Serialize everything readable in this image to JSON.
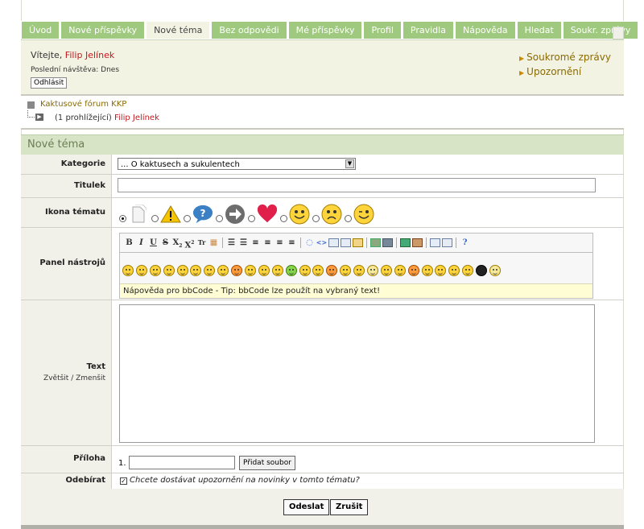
{
  "tabs": [
    {
      "label": "Úvod"
    },
    {
      "label": "Nové příspěvky"
    },
    {
      "label": "Nové téma",
      "active": true
    },
    {
      "label": "Bez odpovědi"
    },
    {
      "label": "Mé příspěvky"
    },
    {
      "label": "Profil"
    },
    {
      "label": "Pravidla"
    },
    {
      "label": "Nápověda"
    },
    {
      "label": "Hledat"
    },
    {
      "label": "Soukr. zprávy"
    }
  ],
  "user": {
    "welcome": "Vítejte,",
    "name": "Filip Jelínek",
    "last_visit": "Poslední návštěva: Dnes",
    "logout": "Odhlásit"
  },
  "right_links": [
    "Soukromé zprávy",
    "Upozornění"
  ],
  "breadcrumb": {
    "forum": "Kaktusové fórum KKP",
    "viewing": "(1 prohlížející)",
    "viewer": "Filip Jelínek"
  },
  "form": {
    "title": "Nové téma",
    "category_label": "Kategorie",
    "category_value": "... O kaktusech a sukulentech",
    "subject_label": "Titulek",
    "icon_label": "Ikona tématu",
    "toolbar_label": "Panel nástrojů",
    "help_text": "Nápověda pro bbCode - Tip: bbCode lze použít na vybraný text!",
    "text_label": "Text",
    "enlarge": "Zvětšit",
    "shrink": "Zmenšit",
    "attachment_label": "Příloha",
    "attachment_num": "1.",
    "add_file": "Přidat soubor",
    "subscribe_label": "Odebírat",
    "subscribe_text": "Chcete dostávat upozornění na novinky v tomto tématu?",
    "submit": "Odeslat",
    "cancel": "Zrušit"
  },
  "colors": {
    "tab": "#9fc97f",
    "header": "#d7e4c6",
    "username": "#c0191f",
    "link": "#8a6a00",
    "help_bg": "#fefdd4"
  },
  "icons": [
    "page-icon",
    "warning-icon",
    "speech-bubble-icon",
    "arrow-right-icon",
    "heart-icon",
    "smiley-happy-icon",
    "smiley-sad-icon",
    "smiley-wink-icon"
  ]
}
